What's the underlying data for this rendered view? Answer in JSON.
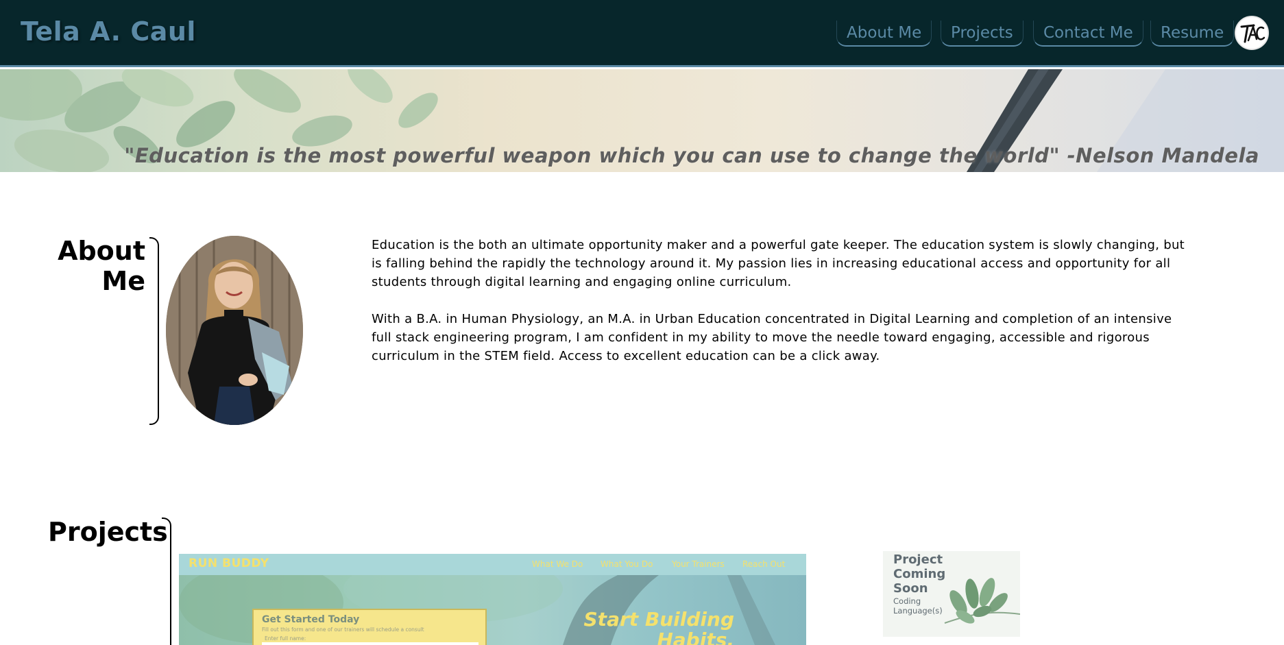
{
  "header": {
    "brand": "Tela A. Caul",
    "nav": [
      "About Me",
      "Projects",
      "Contact Me",
      "Resume"
    ],
    "logo_text": "TAC"
  },
  "hero": {
    "quote": "\"Education is the most powerful weapon which you can use to change the world\" -Nelson Mandela"
  },
  "about": {
    "title_line1": "About",
    "title_line2": "Me",
    "paragraph1": "Education is the both an ultimate opportunity maker and a powerful gate keeper. The education system is slowly changing, but is falling behind the rapidly the technology around it. My passion lies in increasing educational access and opportunity for all students through digital learning and engaging online curriculum.",
    "paragraph2": "With a B.A. in Human Physiology, an M.A. in Urban Education concentrated in Digital Learning and completion of an intensive full stack engineering program, I am confident in my ability to move the needle toward engaging, accessible and rigorous curriculum in the STEM field. Access to excellent education can be a click away."
  },
  "projects": {
    "title": "Projects",
    "run_buddy": {
      "logo": "RUN BUDDY",
      "nav": [
        "What We Do",
        "What You Do",
        "Your Trainers",
        "Reach Out"
      ],
      "form_title": "Get Started Today",
      "form_sub": "Fill out this form and one of our trainers will schedule a consult",
      "form_label": "Enter full name:",
      "hero_line1": "Start Building",
      "hero_line2": "Habits."
    },
    "coming_soon": {
      "title_line1": "Project",
      "title_line2": "Coming",
      "title_line3": "Soon",
      "sub_line1": "Coding",
      "sub_line2": "Language(s)"
    }
  },
  "colors": {
    "header_bg": "#07262b",
    "accent": "#5b8aa6",
    "quote_text": "#5e5e5e",
    "run_buddy_yellow": "#f4e16d"
  }
}
